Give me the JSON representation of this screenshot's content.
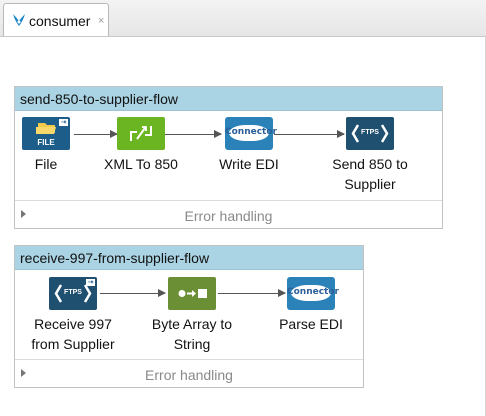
{
  "tab": {
    "label": "consumer",
    "close": "×",
    "icon": "mule-icon"
  },
  "flows": [
    {
      "title": "send-850-to-supplier-flow",
      "nodes": [
        {
          "label": "File",
          "icon": "file-connector-icon"
        },
        {
          "label": "XML To 850",
          "icon": "transformer-icon"
        },
        {
          "label": "Write EDI",
          "icon": "connector-icon"
        },
        {
          "label": "Send 850 to Supplier",
          "icon": "ftps-icon"
        }
      ],
      "error_handling": "Error handling"
    },
    {
      "title": "receive-997-from-supplier-flow",
      "nodes": [
        {
          "label": "Receive 997 from Supplier",
          "icon": "ftps-icon"
        },
        {
          "label": "Byte Array to String",
          "icon": "byte-array-transformer-icon"
        },
        {
          "label": "Parse EDI",
          "icon": "connector-icon"
        }
      ],
      "error_handling": "Error handling"
    }
  ],
  "icon_texts": {
    "file": "FILE",
    "connector": "Connector",
    "ftps": "FTPS"
  },
  "colors": {
    "flow_header": "#aad3e3",
    "transformer": "#6cb522",
    "connector": "#2b82b9",
    "ftps": "#1f5070",
    "byte_array": "#6b8f34",
    "file": "#1c5d8a"
  }
}
